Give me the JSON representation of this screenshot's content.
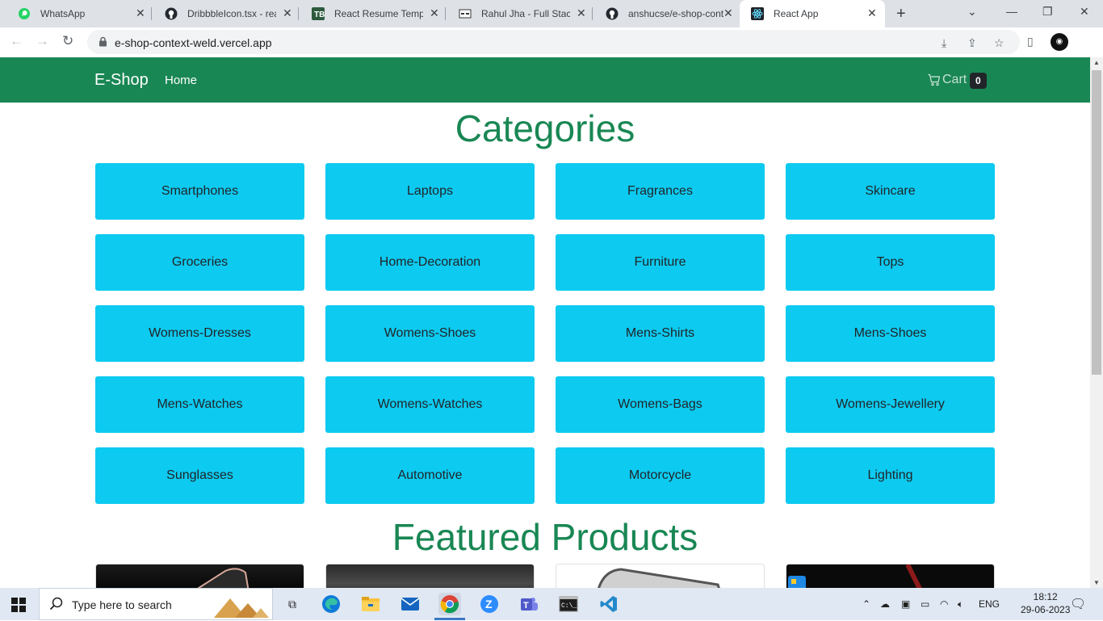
{
  "browser": {
    "tabs": [
      {
        "title": "WhatsApp",
        "icon": "whatsapp-icon",
        "active": false
      },
      {
        "title": "DribbbleIcon.tsx - reac",
        "icon": "github-icon",
        "active": false
      },
      {
        "title": "React Resume Templat",
        "icon": "tb-icon",
        "active": false
      },
      {
        "title": "Rahul Jha - Full Stack",
        "icon": "site-icon",
        "active": false
      },
      {
        "title": "anshucse/e-shop-cont",
        "icon": "github-icon",
        "active": false
      },
      {
        "title": "React App",
        "icon": "react-icon",
        "active": true
      }
    ],
    "url": "e-shop-context-weld.vercel.app"
  },
  "app": {
    "brand": "E-Shop",
    "nav_home": "Home",
    "cart_label": "Cart",
    "cart_count": "0",
    "colors": {
      "navbar": "#198754",
      "category_button": "#0dcaf0",
      "heading": "#198754"
    }
  },
  "categories": {
    "title": "Categories",
    "items": [
      "Smartphones",
      "Laptops",
      "Fragrances",
      "Skincare",
      "Groceries",
      "Home-Decoration",
      "Furniture",
      "Tops",
      "Womens-Dresses",
      "Womens-Shoes",
      "Mens-Shirts",
      "Mens-Shoes",
      "Mens-Watches",
      "Womens-Watches",
      "Womens-Bags",
      "Womens-Jewellery",
      "Sunglasses",
      "Automotive",
      "Motorcycle",
      "Lighting"
    ]
  },
  "featured": {
    "title": "Featured Products"
  },
  "taskbar": {
    "search_placeholder": "Type here to search",
    "language": "ENG",
    "time": "18:12",
    "date": "29-06-2023"
  }
}
